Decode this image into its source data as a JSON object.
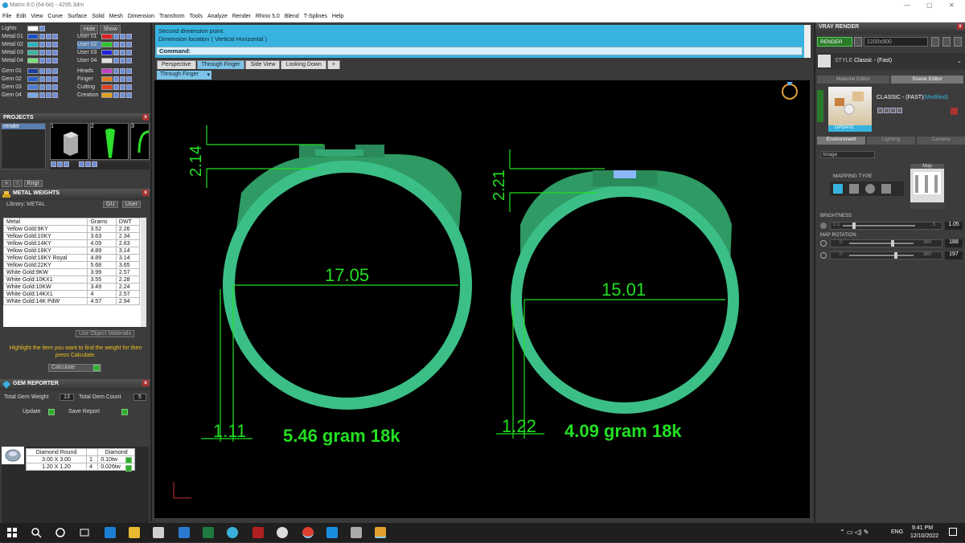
{
  "titlebar": {
    "title": "Matrix 8.0 (64-bit) - 4295.3dm",
    "min": "—",
    "max": "▢",
    "close": "✕"
  },
  "menu": [
    "File",
    "Edit",
    "View",
    "Curve",
    "Surface",
    "Solid",
    "Mesh",
    "Dimension",
    "Transform",
    "Tools",
    "Analyze",
    "Render",
    "Rhino 5.0",
    "Blend",
    "T-Splines",
    "Help"
  ],
  "layers": {
    "left": [
      {
        "name": "Lights",
        "color": "#ffffff"
      },
      {
        "name": "Metal 01",
        "color": "#1a50c8"
      },
      {
        "name": "Metal 02",
        "color": "#2ab5c0"
      },
      {
        "name": "Metal 03",
        "color": "#3fb4a0"
      },
      {
        "name": "Metal 04",
        "color": "#7ce07c"
      },
      {
        "name": "Gem 01",
        "color": "#1a3fa0"
      },
      {
        "name": "Gem 02",
        "color": "#2a5fd0"
      },
      {
        "name": "Gem 03",
        "color": "#4a7fd8"
      },
      {
        "name": "Gem 04",
        "color": "#7aa8e8"
      }
    ],
    "right": [
      {
        "name": "User 01",
        "color": "#e02020"
      },
      {
        "name": "User 02",
        "color": "#28c828"
      },
      {
        "name": "User 03",
        "color": "#2020e0"
      },
      {
        "name": "User 04",
        "color": "#e0e0e0"
      },
      {
        "name": "Heads",
        "color": "#c040c0"
      },
      {
        "name": "Finger",
        "color": "#e08020"
      },
      {
        "name": "Cutting",
        "color": "#e04020"
      },
      {
        "name": "Creation",
        "color": "#e0a020"
      }
    ],
    "hide": "Hide",
    "show": "Show"
  },
  "projects": {
    "title": "PROJECTS",
    "item": "render",
    "thumbs": [
      "1",
      "2",
      "3"
    ],
    "ring_label": "Rngr"
  },
  "metal": {
    "title": "METAL WEIGHTS",
    "library": "Library: METAL",
    "btn_gu": "GU",
    "btn_user": "User",
    "headers": [
      "Metal",
      "Grams",
      "DWT"
    ],
    "rows": [
      [
        "Yellow Gold:9KY",
        "3.52",
        "2.26"
      ],
      [
        "Yellow Gold:10KY",
        "3.63",
        "2.34"
      ],
      [
        "Yellow Gold:14KY",
        "4.09",
        "2.63"
      ],
      [
        "Yellow Gold:18KY",
        "4.89",
        "3.14"
      ],
      [
        "Yellow Gold:18KY Royal",
        "4.89",
        "3.14"
      ],
      [
        "Yellow Gold:22KY",
        "5.68",
        "3.65"
      ],
      [
        "White Gold:9KW",
        "3.99",
        "2.57"
      ],
      [
        "White Gold:10KX1",
        "3.55",
        "2.28"
      ],
      [
        "White Gold:10KW",
        "3.49",
        "2.24"
      ],
      [
        "White Gold:14KX1",
        "4",
        "2.57"
      ],
      [
        "White Gold:14K PdW",
        "4.57",
        "2.94"
      ]
    ],
    "use_object": "Use Object Materials",
    "hint": "Highlight the item you want to find the weight for then press Calculate.",
    "calc": "Calculate"
  },
  "gem": {
    "title": "GEM REPORTER",
    "total_weight_label": "Total Gem Weight",
    "total_weight": "13",
    "total_count_label": "Total Gem Count",
    "total_count": "5",
    "update": "Update",
    "save": "Save Report",
    "headers": [
      "Diamond Round",
      "",
      "Diamond"
    ],
    "rows": [
      [
        "3.00 X 3.00",
        "1",
        "0.10tw"
      ],
      [
        "1.20 X 1.20",
        "4",
        "0.026tw"
      ]
    ]
  },
  "command": {
    "line1": "Second dimension point.",
    "line2": "Dimension location ( Vertical  Horizontal )",
    "label": "Command:"
  },
  "tabs": [
    "Perspective",
    "Through Finger",
    "Side View",
    "Looking Down",
    "+"
  ],
  "subtab": "Through Finger",
  "viewport": {
    "ring1": {
      "dia": "17.05",
      "height": "2.14",
      "width": "1.11",
      "weight": "5.46 gram 18k"
    },
    "ring2": {
      "dia": "15.01",
      "height": "2.21",
      "width": "1.22",
      "weight": "4.09 gram 18k"
    }
  },
  "vray": {
    "title": "VRAY RENDER",
    "render": "RENDER",
    "res": "1200x900",
    "style_label": "STYLE",
    "style": "Classic - (Fast)",
    "tab_mat": "Material Editor",
    "tab_scene": "Scene Editor",
    "preset": "CLASSIC - (FAST)",
    "modified": "(Modified)",
    "update": "UPDATE",
    "env_tabs": [
      "Environment",
      "Lighting",
      "Camera"
    ],
    "image_sel": "Image",
    "mapping": "MAPPING TYPE",
    "map": "Map",
    "brightness_label": "BRIGHTNESS",
    "b_min": "0.1",
    "b_max": "5",
    "brightness": "1.05",
    "rotation_label": "MAP ROTATION",
    "r1_min": "0",
    "r1_max": "360",
    "r1": "188",
    "r2_min": "0",
    "r2_max": "360",
    "r2": "197"
  },
  "taskbar": {
    "lang": "ENG",
    "time": "9:41 PM",
    "date": "12/10/2022"
  }
}
